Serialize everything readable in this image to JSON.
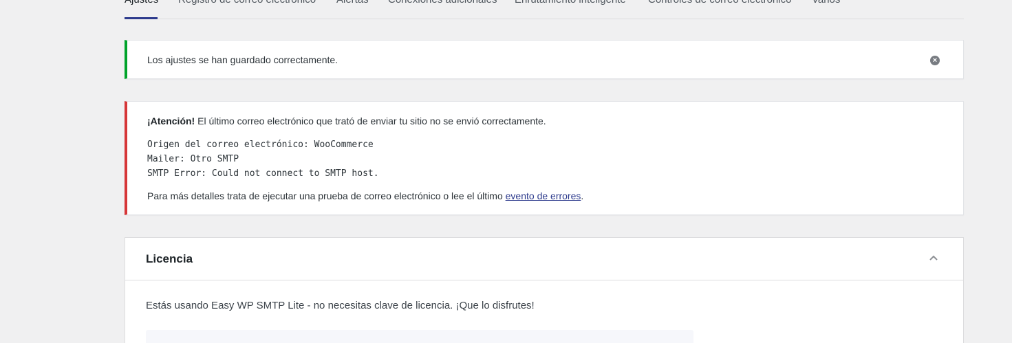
{
  "tabs": [
    {
      "label": "Ajustes"
    },
    {
      "label": "Registro de correo electrónico"
    },
    {
      "label": "Alertas"
    },
    {
      "label": "Conexiones adicionales"
    },
    {
      "label": "Enrutamiento inteligente"
    },
    {
      "label": "Controles de correo electrónico"
    },
    {
      "label": "Varios"
    }
  ],
  "success_notice": {
    "message": "Los ajustes se han guardado correctamente.",
    "dismiss_icon": "close-circle-icon",
    "color": "#00a32a"
  },
  "error_notice": {
    "strong": "¡Atención!",
    "message": " El último correo electrónico que trató de enviar tu sitio no se envió correctamente.",
    "log_lines": [
      "Origen del correo electrónico: WooCommerce",
      "Mailer: Otro SMTP",
      "SMTP Error: Could not connect to SMTP host."
    ],
    "details_prefix": "Para más detalles trata de ejecutar una prueba de correo electrónico o lee el último ",
    "details_link": "evento de errores",
    "details_suffix": ".",
    "color": "#d63638"
  },
  "license_card": {
    "title": "Licencia",
    "toggle_icon": "chevron-up-icon",
    "text": "Estás usando Easy WP SMTP Lite - no necesitas clave de licencia. ¡Que lo disfrutes!"
  }
}
